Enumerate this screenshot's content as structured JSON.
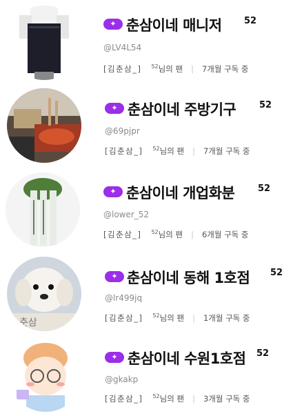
{
  "rows": [
    {
      "name": "춘삼이네 매니저",
      "level": "52",
      "handle": "@LV4L54",
      "tag": "[김춘삼_]",
      "fan_level": "52",
      "fan_suffix": "님의 팬",
      "subscription": "7개월 구독 중"
    },
    {
      "name": "춘삼이네 주방기구",
      "level": "52",
      "handle": "@69pjpr",
      "tag": "[김춘삼_]",
      "fan_level": "52",
      "fan_suffix": "님의 팬",
      "subscription": "7개월 구독 중"
    },
    {
      "name": "춘삼이네 개업화분",
      "level": "52",
      "handle": "@lower_52",
      "tag": "[김춘삼_]",
      "fan_level": "52",
      "fan_suffix": "님의 팬",
      "subscription": "6개월 구독 중"
    },
    {
      "name": "춘삼이네 동해 1호점",
      "level": "52",
      "handle": "@lr499jq",
      "tag": "[김춘삼_]",
      "fan_level": "52",
      "fan_suffix": "님의 팬",
      "subscription": "1개월 구독 중"
    },
    {
      "name": "춘삼이네 수원1호점",
      "level": "52",
      "handle": "@gkakp",
      "tag": "[김춘삼_]",
      "fan_level": "52",
      "fan_suffix": "님의 팬",
      "subscription": "3개월 구독 중"
    }
  ],
  "avatar_text": "춘삼",
  "badge_icon": "sparkle-icon",
  "colors": {
    "badge": "#9b2ee8",
    "name": "#111111",
    "handle": "#8a8a8a"
  }
}
